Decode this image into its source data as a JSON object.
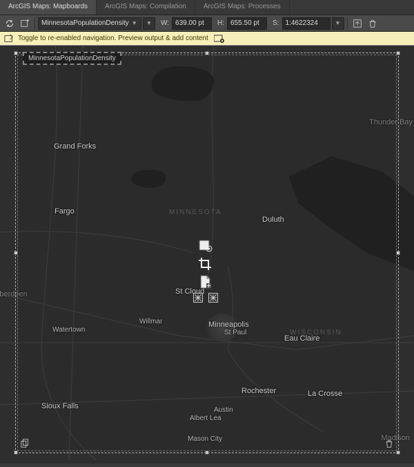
{
  "tabs": {
    "mapboards": "ArcGIS Maps: Mapboards",
    "compilation": "ArcGIS Maps: Compilation",
    "processes": "ArcGIS Maps: Processes"
  },
  "toolbar": {
    "doc_dropdown": "MinnesotaPopulationDensity",
    "w_label": "W:",
    "w_value": "639.00 pt",
    "h_label": "H:",
    "h_value": "655.50 pt",
    "s_label": "S:",
    "s_value": "1:4622324"
  },
  "notice": {
    "text": "Toggle to re-enabled navigation. Preview output & add content"
  },
  "artboard": {
    "title": "MinnesotaPopulationDensity"
  },
  "states": {
    "mn": "MINNESOTA",
    "wi": "WISCONSIN"
  },
  "cities": {
    "grand_forks": "Grand Forks",
    "thunder_bay": "Thunder Bay",
    "fargo": "Fargo",
    "duluth": "Duluth",
    "st_cloud": "St Cloud",
    "aberdeen": "Aberdeen",
    "watertown": "Watertown",
    "willmar": "Willmar",
    "minneapolis": "Minneapolis",
    "st_paul": "St Paul",
    "eau_claire": "Eau Claire",
    "sioux_falls": "Sioux Falls",
    "rochester": "Rochester",
    "austin": "Austin",
    "albert_lea": "Albert Lea",
    "la_crosse": "La Crosse",
    "mason_city": "Mason City",
    "madison": "Madison"
  }
}
